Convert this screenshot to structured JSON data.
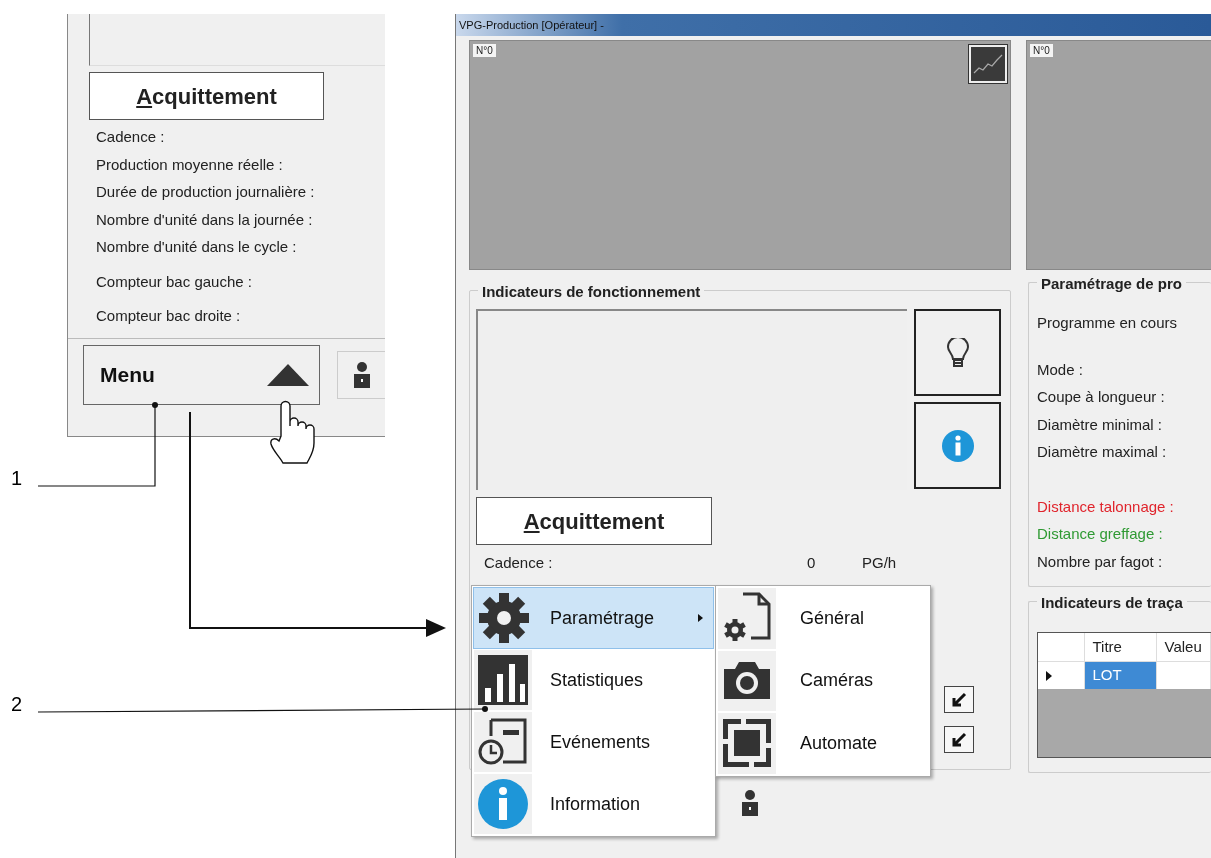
{
  "left_panel": {
    "acknowledge_button": "Acquittement",
    "labels": [
      "Cadence :",
      "Production moyenne réelle :",
      "Durée de production journalière :",
      "Nombre d'unité dans la journée :",
      "Nombre d'unité dans le cycle :"
    ],
    "counters": [
      "Compteur bac gauche :",
      "Compteur bac droite :"
    ],
    "menu_button": "Menu"
  },
  "window": {
    "title": "VPG-Production [Opérateur] -",
    "camera_views": [
      {
        "label": "N°0"
      },
      {
        "label": "N°0"
      }
    ],
    "operation_indicators": {
      "title": "Indicateurs de fonctionnement",
      "acknowledge_button": "Acquittement",
      "rows": [
        {
          "label": "Cadence :",
          "value": "0",
          "unit": "PG/h"
        }
      ]
    },
    "production_settings": {
      "title": "Paramétrage de pro",
      "groups": [
        {
          "fields": [
            {
              "label": "Programme en cours",
              "color": "#222222"
            }
          ]
        },
        {
          "fields": [
            {
              "label": "Mode :",
              "color": "#222222"
            },
            {
              "label": "Coupe à longueur :",
              "color": "#222222"
            },
            {
              "label": "Diamètre minimal :",
              "color": "#222222"
            },
            {
              "label": "Diamètre maximal :",
              "color": "#222222"
            }
          ]
        },
        {
          "fields": [
            {
              "label": "Distance talonnage :",
              "color": "#e0242c"
            },
            {
              "label": "Distance greffage :",
              "color": "#2f9a33"
            },
            {
              "label": "Nombre par fagot :",
              "color": "#222222"
            }
          ]
        }
      ]
    },
    "traceability": {
      "title": "Indicateurs de traça",
      "columns": [
        "Titre",
        "Valeu"
      ],
      "rows": [
        {
          "cells": [
            "LOT"
          ],
          "selected": true
        }
      ]
    },
    "menu": {
      "items": [
        {
          "label": "Paramétrage",
          "selected": true,
          "has_submenu": true
        },
        {
          "label": "Statistiques",
          "selected": false,
          "has_submenu": false
        },
        {
          "label": "Evénements",
          "selected": false,
          "has_submenu": false
        },
        {
          "label": "Information",
          "selected": false,
          "has_submenu": false
        }
      ]
    },
    "submenu": {
      "items": [
        {
          "label": "Général",
          "selected": false
        },
        {
          "label": "Caméras",
          "selected": false
        },
        {
          "label": "Automate",
          "selected": false
        }
      ]
    }
  },
  "callouts": [
    {
      "label": "1"
    },
    {
      "label": "2"
    }
  ]
}
